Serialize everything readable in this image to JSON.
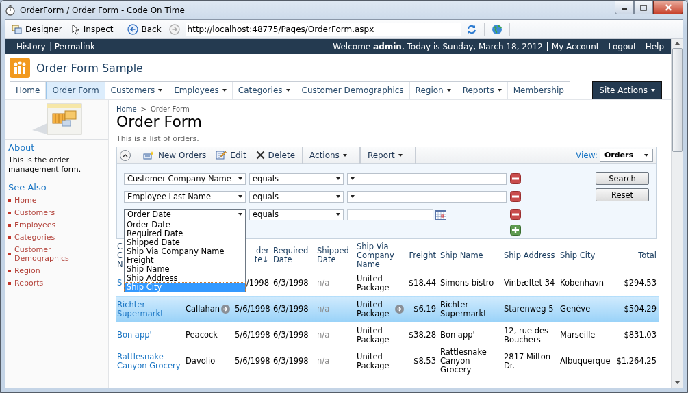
{
  "window": {
    "title": "OrderForm / Order Form - Code On Time"
  },
  "browser_toolbar": {
    "designer": "Designer",
    "inspect": "Inspect",
    "back": "Back",
    "address": "http://localhost:48775/Pages/OrderForm.aspx"
  },
  "top_bar": {
    "left_links": [
      "History",
      "Permalink"
    ],
    "welcome": "Welcome **admin**, Today is Sunday, March 18, 2012",
    "right_links": [
      "My Account",
      "Logout",
      "Help"
    ]
  },
  "site": {
    "title": "Order Form Sample"
  },
  "menu": {
    "items": [
      {
        "label": "Home",
        "has_dropdown": false,
        "selected": false
      },
      {
        "label": "Order Form",
        "has_dropdown": false,
        "selected": true
      },
      {
        "label": "Customers",
        "has_dropdown": true,
        "selected": false
      },
      {
        "label": "Employees",
        "has_dropdown": true,
        "selected": false
      },
      {
        "label": "Categories",
        "has_dropdown": true,
        "selected": false
      },
      {
        "label": "Customer Demographics",
        "has_dropdown": false,
        "selected": false
      },
      {
        "label": "Region",
        "has_dropdown": true,
        "selected": false
      },
      {
        "label": "Reports",
        "has_dropdown": true,
        "selected": false
      },
      {
        "label": "Membership",
        "has_dropdown": false,
        "selected": false
      }
    ],
    "site_actions": "Site Actions"
  },
  "sidebar": {
    "about_title": "About",
    "about_text": "This is the order management form.",
    "see_also_title": "See Also",
    "links": [
      "Home",
      "Customers",
      "Employees",
      "Categories",
      "Customer Demographics",
      "Region",
      "Reports"
    ]
  },
  "breadcrumb": {
    "items": [
      "Home",
      "Order Form"
    ],
    "separator": ">"
  },
  "page_title": "Order Form",
  "description": "This is a list of orders.",
  "action_bar": {
    "items": [
      {
        "label": "New Orders",
        "kind": "new"
      },
      {
        "label": "Edit",
        "kind": "edit"
      },
      {
        "label": "Delete",
        "kind": "delete"
      },
      {
        "label": "Actions",
        "kind": "menu"
      },
      {
        "label": "Report",
        "kind": "menu"
      }
    ],
    "view_label": "View:",
    "view_value": "Orders"
  },
  "filters": [
    {
      "field": "Customer Company Name",
      "operator": "equals",
      "kind": "select"
    },
    {
      "field": "Employee Last Name",
      "operator": "equals",
      "kind": "select"
    },
    {
      "field": "Order Date",
      "operator": "equals",
      "kind": "date",
      "expanded": true
    }
  ],
  "filter_buttons": [
    "Search",
    "Reset"
  ],
  "field_list": {
    "options": [
      {
        "label": "Order Date",
        "selected": false
      },
      {
        "label": "Required Date",
        "selected": false
      },
      {
        "label": "Shipped Date",
        "selected": false
      },
      {
        "label": "Ship Via Company Name",
        "selected": false
      },
      {
        "label": "Freight",
        "selected": false
      },
      {
        "label": "Ship Name",
        "selected": false
      },
      {
        "label": "Ship Address",
        "selected": false
      },
      {
        "label": "Ship City",
        "selected": true
      }
    ]
  },
  "table": {
    "columns": [
      {
        "header": "C\nC\nN",
        "kind": "link"
      },
      {
        "kind": "lookup"
      },
      {
        "header": "der\nte↓",
        "kind": "sorted"
      },
      {
        "header": "Required Date",
        "kind": "text"
      },
      {
        "header": "Shipped Date",
        "kind": "muted"
      },
      {
        "header": "Ship Via Company Name",
        "kind": "lookup"
      },
      {
        "header": "Freight",
        "kind": "money"
      },
      {
        "header": "Ship Name",
        "kind": "text"
      },
      {
        "header": "Ship Address",
        "kind": "text"
      },
      {
        "header": "Ship City",
        "kind": "text"
      },
      {
        "header": "Total",
        "kind": "money"
      }
    ],
    "rows": [
      {
        "selected": false,
        "cells": [
          "S",
          null,
          "/1998",
          "6/3/1998",
          "n/a",
          "United Package",
          "$18.44",
          "Simons bistro",
          "Vinbæltet 34",
          "Kobenhavn",
          "$294.53"
        ]
      },
      {
        "selected": true,
        "cells": [
          "Richter Supermarkt",
          "Callahan",
          "5/6/1998",
          "6/3/1998",
          "n/a",
          "United Package",
          "$6.19",
          "Richter Supermarkt",
          "Starenweg 5",
          "Genève",
          "$504.29"
        ]
      },
      {
        "selected": false,
        "cells": [
          "Bon app'",
          "Peacock",
          "5/6/1998",
          "6/3/1998",
          "n/a",
          "United Package",
          "$38.28",
          "Bon app'",
          "12, rue des Bouchers",
          "Marseille",
          "$831.03"
        ]
      },
      {
        "selected": false,
        "cells": [
          "Rattlesnake Canyon Grocery",
          "Davolio",
          "5/6/1998",
          "6/3/1998",
          "n/a",
          "United Package",
          "$8.53",
          "Rattlesnake Canyon Grocery",
          "2817 Milton Dr.",
          "Albuquerque",
          "$1,264.25"
        ]
      }
    ]
  }
}
